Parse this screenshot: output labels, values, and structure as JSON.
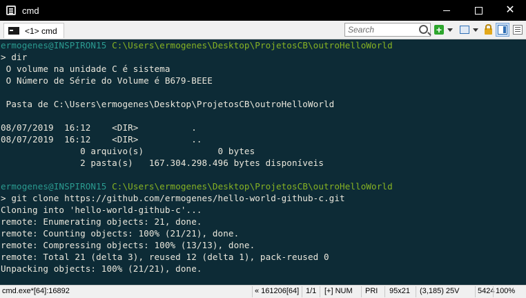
{
  "window": {
    "title": "cmd",
    "controls": {
      "minimize": "",
      "maximize": "",
      "close": "✕"
    }
  },
  "tabbar": {
    "tab_label": "<1> cmd",
    "search_placeholder": "Search"
  },
  "console": {
    "prompt1_user": "ermogenes@INSPIRON15",
    "prompt1_path": " C:\\Users\\ermogenes\\Desktop\\ProjetosCB\\outroHelloWorld",
    "cmd1": "> dir",
    "out1": " O volume na unidade C é sistema",
    "out2": " O Número de Série do Volume é B679-BEEE",
    "out3": " Pasta de C:\\Users\\ermogenes\\Desktop\\ProjetosCB\\outroHelloWorld",
    "out4": "08/07/2019  16:12    <DIR>          .",
    "out5": "08/07/2019  16:12    <DIR>          ..",
    "out6": "               0 arquivo(s)              0 bytes",
    "out7": "               2 pasta(s)   167.304.298.496 bytes disponíveis",
    "prompt2_user": "ermogenes@INSPIRON15",
    "prompt2_path": " C:\\Users\\ermogenes\\Desktop\\ProjetosCB\\outroHelloWorld",
    "cmd2": "> git clone https://github.com/ermogenes/hello-world-github-c.git",
    "out8": "Cloning into 'hello-world-github-c'...",
    "out9": "remote: Enumerating objects: 21, done.",
    "out10": "remote: Counting objects: 100% (21/21), done.",
    "out11": "remote: Compressing objects: 100% (13/13), done.",
    "out12": "remote: Total 21 (delta 3), reused 12 (delta 1), pack-reused 0",
    "out13": "Unpacking objects: 100% (21/21), done."
  },
  "statusbar": {
    "process": "cmd.exe*[64]:16892",
    "position": "« 161206[64]",
    "page": "1/1",
    "mode": "[+] NUM",
    "priority": "PRI",
    "size": "95x21",
    "cursor": "(3,185) 25V",
    "pid": "5424",
    "zoom": "100%"
  },
  "colors": {
    "background": "#0d2b36",
    "prompt_user": "#2a9b90",
    "prompt_path": "#86b223",
    "text": "#eae7dc"
  }
}
